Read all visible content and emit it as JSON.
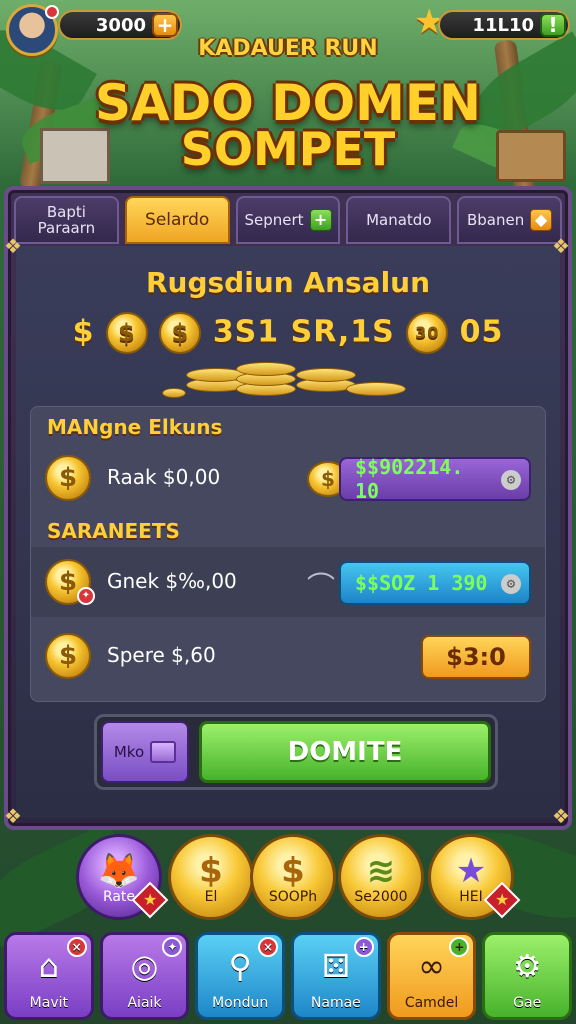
{
  "header": {
    "coins": "3000",
    "gems": "11L10"
  },
  "title": {
    "subtitle": "KADAUER RUN",
    "line1": "SADO DOMEN",
    "line2": "SOMPET"
  },
  "tabs": [
    {
      "label": "Bapti\nParaarn"
    },
    {
      "label": "Selardo"
    },
    {
      "label": "Sepnert"
    },
    {
      "label": "Manatdo"
    },
    {
      "label": "Bbanen"
    }
  ],
  "panel": {
    "heading": "Rugsdiun Ansalun",
    "amount_left": "$",
    "amount_mid": "3S1 SR,1S",
    "amount_coin": "30",
    "amount_right": "05",
    "section1": "MANgne Elkuns",
    "section2": "SARANEETS",
    "rows": [
      {
        "label": "Raak $0,00",
        "value": "$$902214. 10"
      },
      {
        "label": "Gnek $‰,00",
        "value": "$$SOZ 1 390"
      },
      {
        "label": "Spere $,60",
        "value": "$3:0"
      }
    ],
    "inbox_label": "Mko",
    "action_label": "DOMITE"
  },
  "circles": [
    {
      "label": "Rate"
    },
    {
      "label": "El"
    },
    {
      "label": "SOOPh"
    },
    {
      "label": "Se2000"
    },
    {
      "label": "HEI"
    }
  ],
  "nav": [
    {
      "label": "Mavit",
      "icon": "house-icon"
    },
    {
      "label": "Aiaik",
      "icon": "spool-icon"
    },
    {
      "label": "Mondun",
      "icon": "wrench-icon"
    },
    {
      "label": "Namae",
      "icon": "dice-icon"
    },
    {
      "label": "Camdel",
      "icon": "link-icon"
    },
    {
      "label": "Gae",
      "icon": "gear-icon"
    }
  ],
  "colors": {
    "accent_gold": "#ffcf3a",
    "panel_purple": "#403052",
    "action_green": "#47b22c"
  }
}
